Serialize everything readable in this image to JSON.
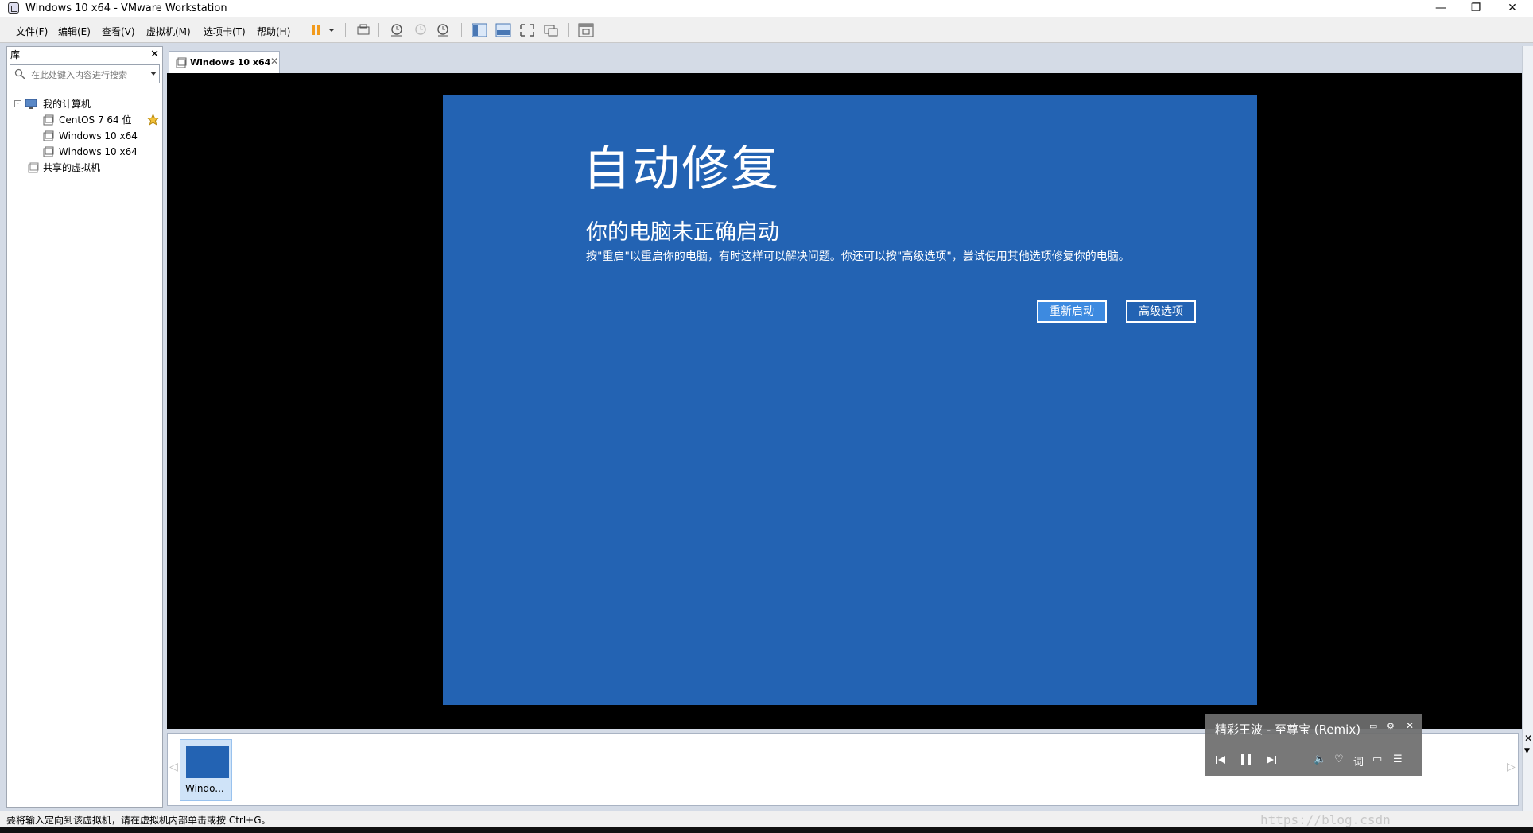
{
  "window": {
    "title": "Windows 10 x64 - VMware Workstation"
  },
  "menu": [
    "文件(F)",
    "编辑(E)",
    "查看(V)",
    "虚拟机(M)",
    "选项卡(T)",
    "帮助(H)"
  ],
  "library": {
    "header": "库",
    "search_placeholder": "在此处键入内容进行搜索",
    "tree": {
      "root": "我的计算机",
      "vms": [
        "CentOS 7 64 位",
        "Windows 10 x64",
        "Windows 10 x64"
      ],
      "shared": "共享的虚拟机"
    }
  },
  "tab": {
    "label": "Windows 10 x64"
  },
  "guest": {
    "title": "自动修复",
    "subtitle": "你的电脑未正确启动",
    "description": "按\"重启\"以重启你的电脑，有时这样可以解决问题。你还可以按\"高级选项\"，尝试使用其他选项修复你的电脑。",
    "restart_button": "重新启动",
    "advanced_button": "高级选项"
  },
  "thumbnail": {
    "label": "Windo..."
  },
  "music_player": {
    "song": "精彩王波 - 至尊宝 (Remix)",
    "lyrics_button": "词"
  },
  "statusbar": {
    "message": "要将输入定向到该虚拟机，请在虚拟机内部单击或按 Ctrl+G。",
    "watermark": "https://blog.csdn"
  },
  "colors": {
    "guest_bg": "#2363b3",
    "accent": "#2b7ad8"
  }
}
